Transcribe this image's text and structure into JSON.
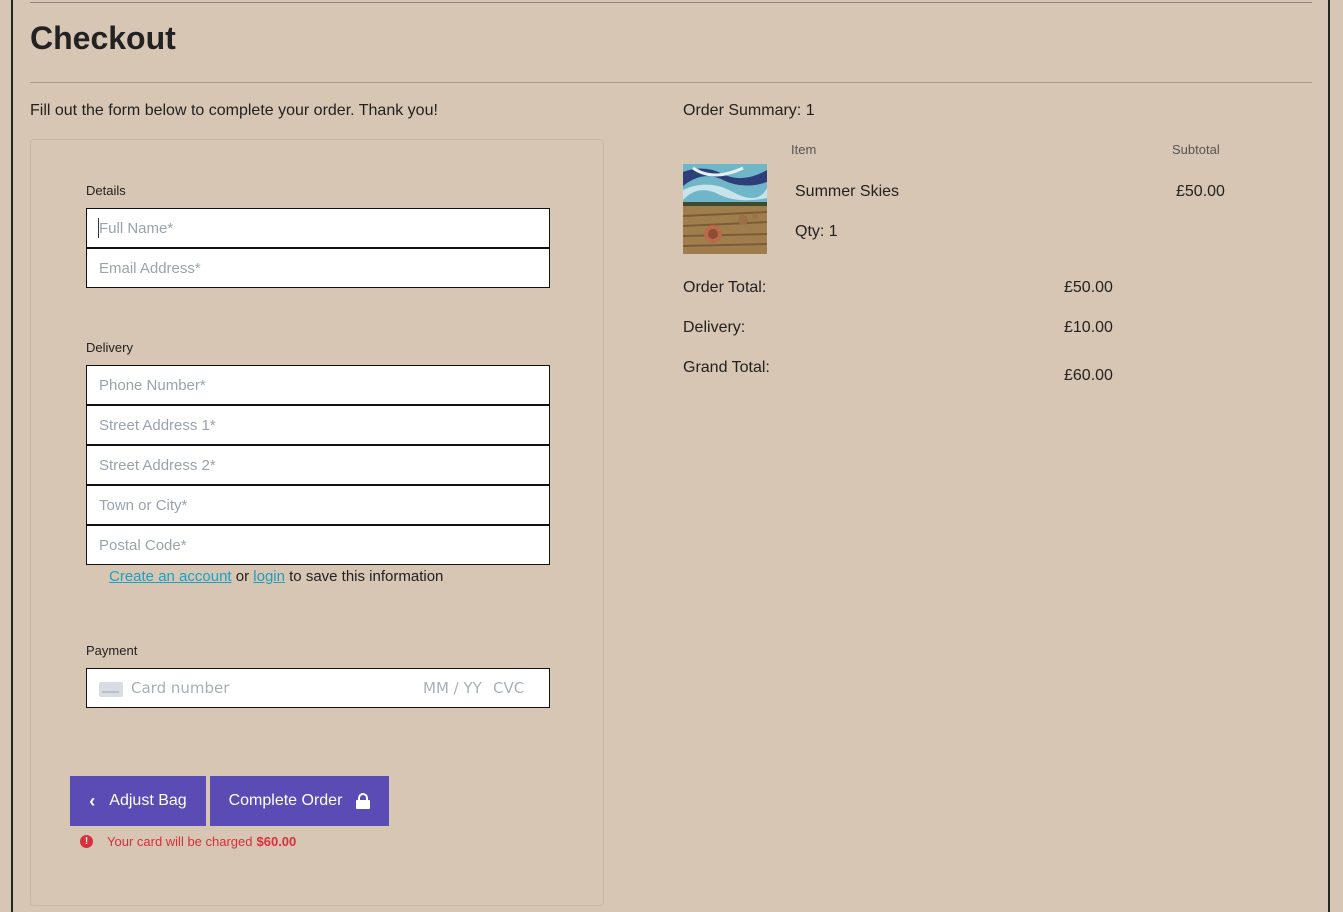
{
  "page": {
    "title": "Checkout",
    "intro": "Fill out the form below to complete your order. Thank you!"
  },
  "form": {
    "details": {
      "legend": "Details",
      "full_name_placeholder": "Full Name*",
      "email_placeholder": "Email Address*"
    },
    "delivery": {
      "legend": "Delivery",
      "phone_placeholder": "Phone Number*",
      "street1_placeholder": "Street Address 1*",
      "street2_placeholder": "Street Address 2*",
      "town_placeholder": "Town or City*",
      "postal_placeholder": "Postal Code*"
    },
    "save_info": {
      "create_account": "Create an account",
      "or": "or",
      "login": "login",
      "suffix": "to save this information"
    },
    "payment": {
      "legend": "Payment",
      "card_number_placeholder": "Card number",
      "expiry_placeholder": "MM / YY",
      "cvc_placeholder": "CVC"
    },
    "buttons": {
      "adjust_bag": "Adjust Bag",
      "complete_order": "Complete Order"
    },
    "charge_note": {
      "text": "Your card will be charged",
      "amount": "$60.00",
      "color": "#d92f3c"
    }
  },
  "summary": {
    "title": "Order Summary: 1",
    "columns": {
      "item": "Item",
      "subtotal": "Subtotal"
    },
    "items": [
      {
        "name": "Summer Skies",
        "qty": "Qty: 1",
        "price": "£50.00"
      }
    ],
    "order_total_label": "Order Total:",
    "order_total_value": "£50.00",
    "delivery_label": "Delivery:",
    "delivery_value": "£10.00",
    "grand_total_label": "Grand Total:",
    "grand_total_value": "£60.00"
  },
  "colors": {
    "background": "#d7c6b3",
    "button": "#5b4cb5",
    "link": "#17a2c6"
  },
  "icons": {
    "back": "chevron-left-icon",
    "lock": "lock-icon",
    "card": "credit-card-icon",
    "alert": "alert-circle-icon"
  }
}
